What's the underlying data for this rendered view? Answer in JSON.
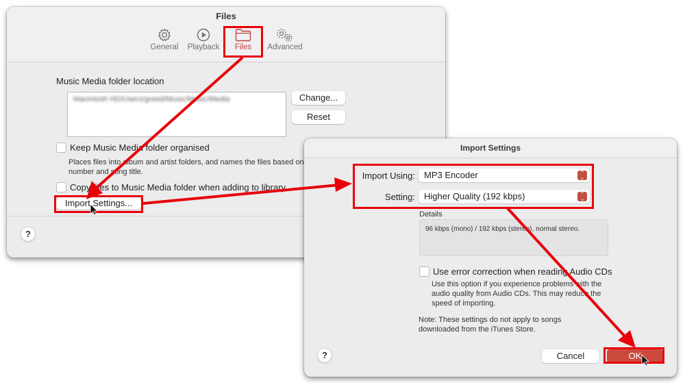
{
  "main_window": {
    "title": "Files",
    "tabs": [
      {
        "label": "General",
        "icon": "gear-icon",
        "active": false
      },
      {
        "label": "Playback",
        "icon": "play-circle-icon",
        "active": false
      },
      {
        "label": "Files",
        "icon": "folder-icon",
        "active": true
      },
      {
        "label": "Advanced",
        "icon": "gears-icon",
        "active": false
      }
    ],
    "folder_location_label": "Music Media folder location",
    "folder_path_blurred": "Macintosh HD/Users/greed/Music/Music/Media",
    "change_button": "Change...",
    "reset_button": "Reset",
    "keep_organised": {
      "label": "Keep Music Media folder organised",
      "checked": false,
      "description_line1": "Places files into album and artist folders, and names the files based on the disc number, track",
      "description_line2": "number and song title."
    },
    "copy_files": {
      "label": "Copy files to Music Media folder when adding to library",
      "checked": false
    },
    "import_settings_button": "Import Settings...",
    "help_button": "?"
  },
  "dialog": {
    "title": "Import Settings",
    "import_using_label": "Import Using:",
    "import_using_value": "MP3 Encoder",
    "setting_label": "Setting:",
    "setting_value": "Higher Quality (192 kbps)",
    "details_label": "Details",
    "details_text": "96 kbps (mono) / 192 kbps (stereo), normal stereo.",
    "error_correction": {
      "label": "Use error correction when reading Audio CDs",
      "checked": false,
      "description_line1": "Use this option if you experience problems with the",
      "description_line2": "audio quality from Audio CDs. This may reduce the",
      "description_line3": "speed of importing."
    },
    "note_line1": "Note: These settings do not apply to songs",
    "note_line2": "downloaded from the iTunes Store.",
    "help_button": "?",
    "cancel_button": "Cancel",
    "ok_button": "OK"
  },
  "annotation_color": "#e8000b",
  "accent_color": "#c0433b"
}
